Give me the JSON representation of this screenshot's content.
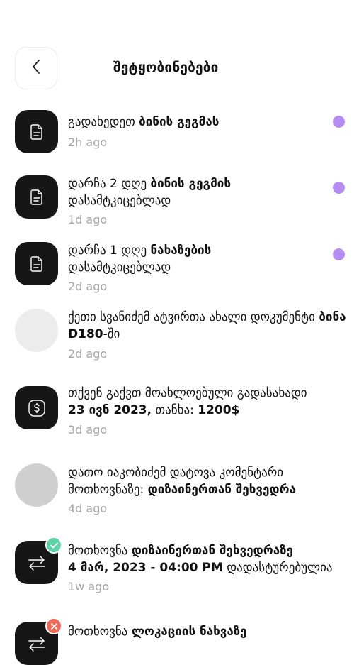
{
  "header": {
    "title": "შეტყობინებები",
    "back_icon": "chevron-left-icon"
  },
  "colors": {
    "unread_dot": "#b58cf2",
    "avatar_dark": "#161616",
    "success_badge": "#5fd3a8",
    "error_badge": "#f06a5a",
    "time_text": "#a6a6a6"
  },
  "notifications": [
    {
      "icon": "document-icon",
      "parts": [
        "გადახედეთ ",
        "ბინის გეგმას"
      ],
      "time": "2h ago",
      "unread": true
    },
    {
      "icon": "document-icon",
      "parts": [
        "დარჩა 2 დღე ",
        "ბინის გეგმის",
        " დასამტკიცებლად"
      ],
      "time": "1d ago",
      "unread": true
    },
    {
      "icon": "document-icon",
      "parts": [
        "დარჩა 1 დღე ",
        "ნახაზების",
        " დასამტკიცებლად"
      ],
      "time": "2d ago",
      "unread": true
    },
    {
      "icon": "user-avatar",
      "parts": [
        "ქეთი სვანიძემ ატვირთა ახალი დოკუმენტი ",
        "ბინა D180",
        "-ში"
      ],
      "time": "2d ago",
      "unread": false
    },
    {
      "icon": "dollar-icon",
      "parts": [
        "თქვენ გაქვთ მოახლოებული გადასახადი ",
        "23 ივნ 2023,",
        " თანხა: ",
        "1200$"
      ],
      "time": "3d ago",
      "unread": false
    },
    {
      "icon": "user-avatar",
      "parts": [
        "დათო იაკობიძემ დატოვა კომენტარი მოთხოვნაზე: ",
        "დიზაინერთან შეხვედრა"
      ],
      "time": "4d ago",
      "unread": false
    },
    {
      "icon": "transfer-arrows-icon",
      "badge": "check-icon",
      "parts": [
        "მოთხოვნა ",
        "დიზაინერთან შეხვედრაზე",
        " ",
        "4 მარ, 2023 - 04:00 PM",
        " დადასტურებულია"
      ],
      "time": "1w ago",
      "unread": false
    },
    {
      "icon": "transfer-arrows-icon",
      "badge": "close-icon",
      "parts": [
        "მოთხოვნა ",
        "ლოკაციის ნახვაზე"
      ],
      "time": "",
      "unread": false
    }
  ]
}
